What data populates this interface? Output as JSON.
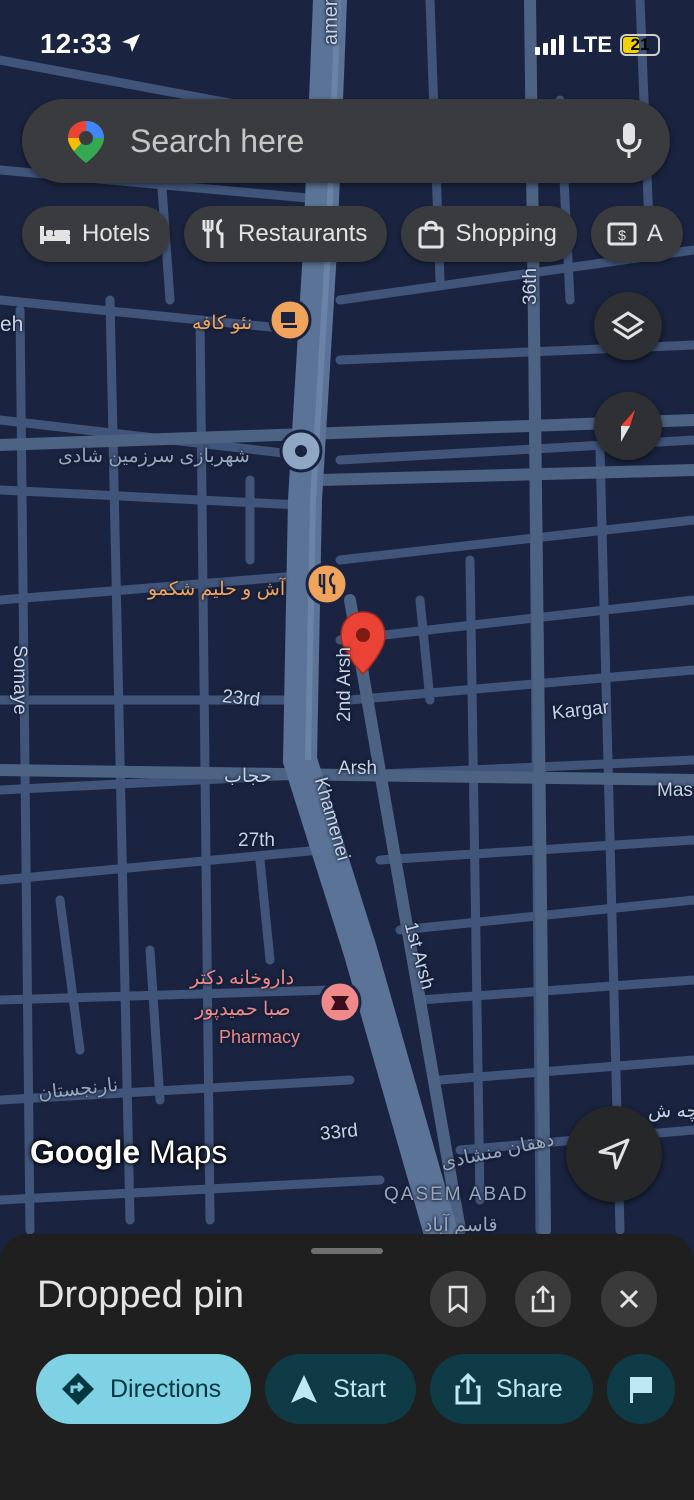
{
  "status_bar": {
    "time": "12:33",
    "network": "LTE",
    "battery": "21"
  },
  "search": {
    "placeholder": "Search here"
  },
  "chips": [
    {
      "icon": "bed-icon",
      "label": "Hotels"
    },
    {
      "icon": "fork-knife-icon",
      "label": "Restaurants"
    },
    {
      "icon": "shopping-bag-icon",
      "label": "Shopping"
    },
    {
      "icon": "atm-icon",
      "label": "A"
    }
  ],
  "map": {
    "labels": {
      "khamenei_top": "amenei",
      "eh": "eh",
      "cafe": "نئو کافه",
      "park": "شهربازی سرزمین شادی",
      "restaurant": "آش و حلیم شکمو",
      "somaye": "Somaye",
      "rd23": "23rd",
      "arsh2": "2nd Arsh",
      "kargar": "Kargar",
      "hejab": "حجاب",
      "arsh": "Arsh",
      "mas": "Mas",
      "khamenei": "Khamenei",
      "th27": "27th",
      "arsh1": "1st Arsh",
      "pharmacy_fa1": "داروخانه دکتر",
      "pharmacy_fa2": "صبا حمیدپور",
      "pharmacy_en": "Pharmacy",
      "narenjestan": "نارنجستان",
      "rd33": "33rd",
      "street36": "36th",
      "dehghan": "دهقان منشادی",
      "qasem_abad": "QASEM ABAD",
      "qasem_abad_fa": "قاسم آباد",
      "bottom_right_fa": "چه ش"
    },
    "branding": {
      "google": "Google",
      "maps": "Maps"
    }
  },
  "sheet": {
    "title": "Dropped pin",
    "actions": [
      {
        "icon": "directions-icon",
        "label": "Directions"
      },
      {
        "icon": "navigation-arrow-icon",
        "label": "Start"
      },
      {
        "icon": "share-icon",
        "label": "Share"
      }
    ]
  },
  "colors": {
    "map_bg": "#1a2440",
    "road": "#4b607f",
    "main_road": "#5a7294",
    "pin": "#ea4335",
    "accent": "#7fd2e3"
  }
}
